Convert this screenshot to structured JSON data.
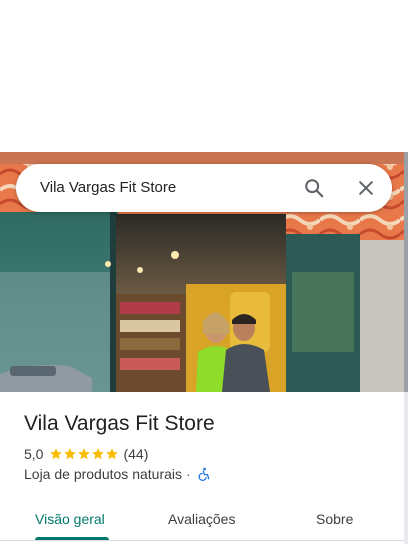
{
  "search": {
    "query": "Vila Vargas Fit Store"
  },
  "place": {
    "name": "Vila Vargas Fit Store",
    "rating": "5,0",
    "stars": 5,
    "review_count": "(44)",
    "category": "Loja de produtos naturais",
    "separator": "·"
  },
  "tabs": [
    {
      "label": "Visão geral",
      "active": true
    },
    {
      "label": "Avaliações",
      "active": false
    },
    {
      "label": "Sobre",
      "active": false
    }
  ],
  "colors": {
    "accent": "#00796b",
    "star": "#fbbc04",
    "accessibility": "#1a73e8"
  },
  "icons": {
    "search": "search-icon",
    "close": "close-icon",
    "accessibility": "wheelchair-accessible-icon"
  }
}
